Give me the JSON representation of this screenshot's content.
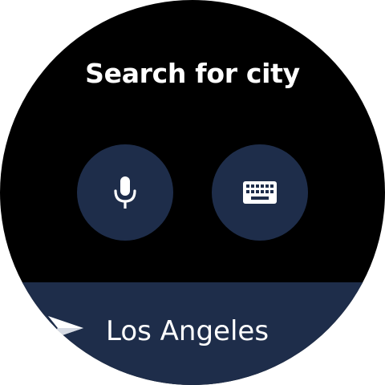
{
  "screen": {
    "title": "Search for city"
  },
  "actions": {
    "voice": {
      "icon": "microphone-icon"
    },
    "keyboard": {
      "icon": "keyboard-icon"
    }
  },
  "results": [
    {
      "label": "Los Angeles",
      "icon": "navigation-arrow-icon"
    }
  ],
  "colors": {
    "background": "#000000",
    "button": "#1e2d4a",
    "text": "#ffffff"
  }
}
